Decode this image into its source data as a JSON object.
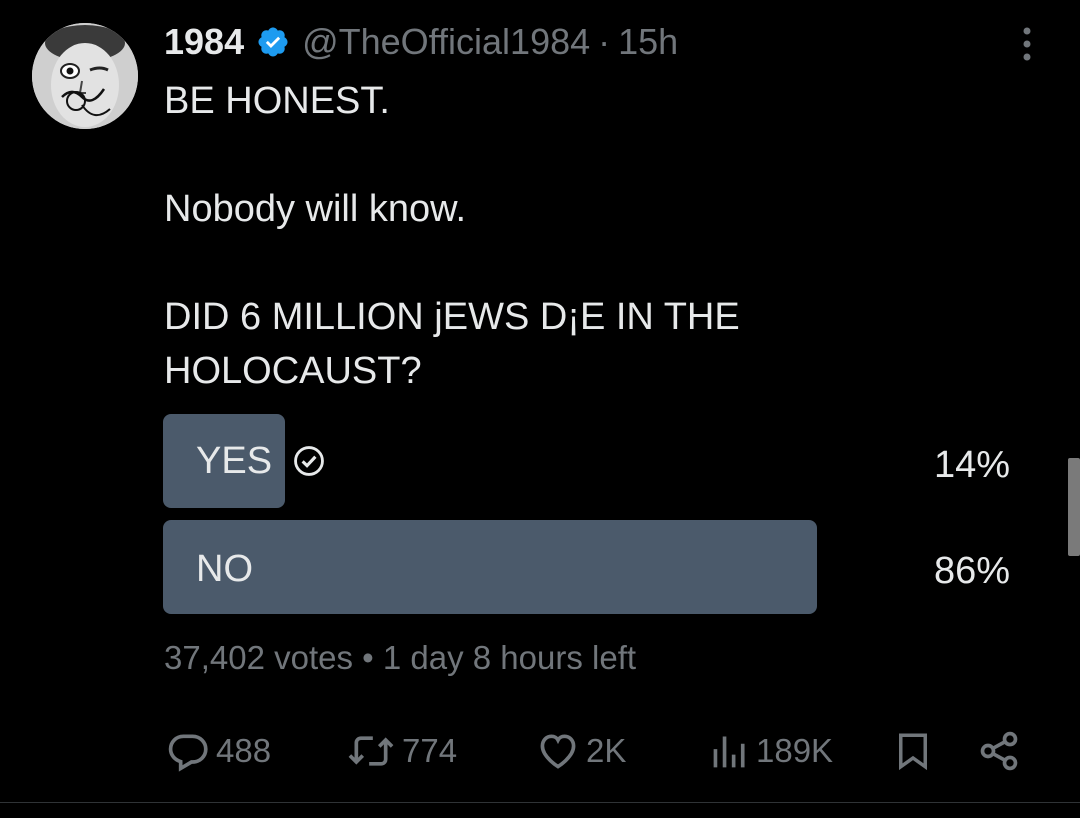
{
  "author": {
    "display_name": "1984",
    "handle": "@TheOfficial1984",
    "separator": "·",
    "time": "15h",
    "verified": true,
    "verified_color": "#1d9bf0"
  },
  "tweet": {
    "line1": "BE HONEST.",
    "line2": "Nobody will know.",
    "line3": "DID 6 MILLION jEWS D¡E IN THE HOLOCAUST?"
  },
  "poll": {
    "options": [
      {
        "label": "YES",
        "percent": "14%",
        "fraction": 0.14,
        "selected": true
      },
      {
        "label": "NO",
        "percent": "86%",
        "fraction": 0.86,
        "selected": false
      }
    ],
    "votes": "37,402 votes",
    "meta_separator": "•",
    "time_left": "1 day 8 hours left",
    "bar_color": "#4b5a6b"
  },
  "actions": {
    "replies": "488",
    "reposts": "774",
    "likes": "2K",
    "views": "189K"
  },
  "icons": {
    "avatar": "profile-photo",
    "verified": "verified-badge-icon",
    "more": "more-options-icon",
    "selected_choice": "check-circle-icon",
    "reply": "reply-icon",
    "repost": "repost-icon",
    "like": "heart-icon",
    "views": "views-chart-icon",
    "bookmark": "bookmark-icon",
    "share": "share-icon"
  }
}
